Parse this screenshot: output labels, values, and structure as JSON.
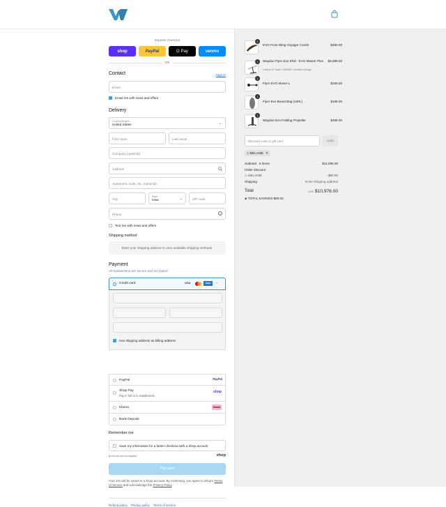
{
  "brand": {
    "accent": "#3a8fd6",
    "logo_color": "#3a96c8"
  },
  "header": {
    "logo_icon": "brand-w-logo-icon",
    "cart_icon": "shopping-bag-icon"
  },
  "express": {
    "title": "Express checkout",
    "shop_pay": "shop",
    "paypal": "PayPal",
    "gpay": "G Pay",
    "venmo": "venmo",
    "or": "OR"
  },
  "contact": {
    "title": "Contact",
    "sign_in": "Sign in",
    "email_placeholder": "Email",
    "newsletter": "Email me with news and offers"
  },
  "delivery": {
    "title": "Delivery",
    "country_label": "Country/Region",
    "country_value": "United States",
    "first_name": "First name",
    "last_name": "Last name",
    "company": "Company (optional)",
    "address": "Address",
    "apartment": "Apartment, suite, etc. (optional)",
    "city": "City",
    "state_label": "State",
    "state_value": "Iowa",
    "zip": "ZIP code",
    "phone": "Phone",
    "sms": "Text me with news and offers"
  },
  "shipping_method": {
    "title": "Shipping method",
    "notice": "Enter your shipping address to view available shipping methods."
  },
  "payment": {
    "title": "Payment",
    "subtitle": "All transactions are secure and encrypted.",
    "credit_card": "Credit card",
    "card_brands": [
      "VISA",
      "MC",
      "AMEX",
      "+"
    ],
    "billing_same": "Use shipping address as billing address",
    "paypal": "PayPal",
    "paypal_logo": "PayPal",
    "shop_pay": "Shop Pay",
    "shop_pay_sub": "Pay in full or in installments",
    "shop_pay_logo": "shop",
    "klarna": "Klarna",
    "klarna_logo": "Klarna",
    "bank": "Bank Deposit"
  },
  "remember": {
    "title": "Remember me",
    "save_info": "Save my information for a faster checkout with a Shop account",
    "secure": "Secure and encrypted",
    "shop_logo": "shop"
  },
  "pay_now": "Pay now",
  "legal": {
    "line1": "Your info will be saved to a Shop account. By continuing, you agree to Shop's",
    "terms": "Terms of Service",
    "and": "and acknowledge the",
    "privacy": "Privacy Policy",
    "end": "."
  },
  "footer_links": [
    "Refund policy",
    "Privacy policy",
    "Terms of service"
  ],
  "order": {
    "items": [
      {
        "name": "EVO Front Wing Voyager C1100",
        "variant": "",
        "qty": "1",
        "price": "$490.00"
      },
      {
        "name": "Waydoo Flyer Evo Efoil - EVO Master Plus",
        "variant": "Carbon 67 Mast / 2200MS / Avenier Orange",
        "qty": "1",
        "price": "$9,699.00"
      },
      {
        "name": "Flyer EVO Mover-L",
        "variant": "",
        "qty": "1",
        "price": "$169.00"
      },
      {
        "name": "Flyer Evo Board Bag (130L)",
        "variant": "",
        "qty": "1",
        "price": "$199.00"
      },
      {
        "name": "Waydoo Evo Folding Propeller",
        "variant": "",
        "qty": "1",
        "price": "$499.00"
      }
    ],
    "discount_placeholder": "Discount code or gift card",
    "apply": "Apply",
    "code_chip": "MELANIE",
    "subtotal_label": "Subtotal · 5 items",
    "subtotal_value": "$11,056.00",
    "order_discount_label": "Order discount",
    "discount_code": "MELANIE",
    "discount_value": "- $80.00",
    "shipping_label": "Shipping",
    "shipping_value": "Enter shipping address",
    "total_label": "Total",
    "currency": "USD",
    "total_value": "$10,976.00",
    "savings_label": "TOTAL SAVINGS",
    "savings_value": "$80.00"
  }
}
